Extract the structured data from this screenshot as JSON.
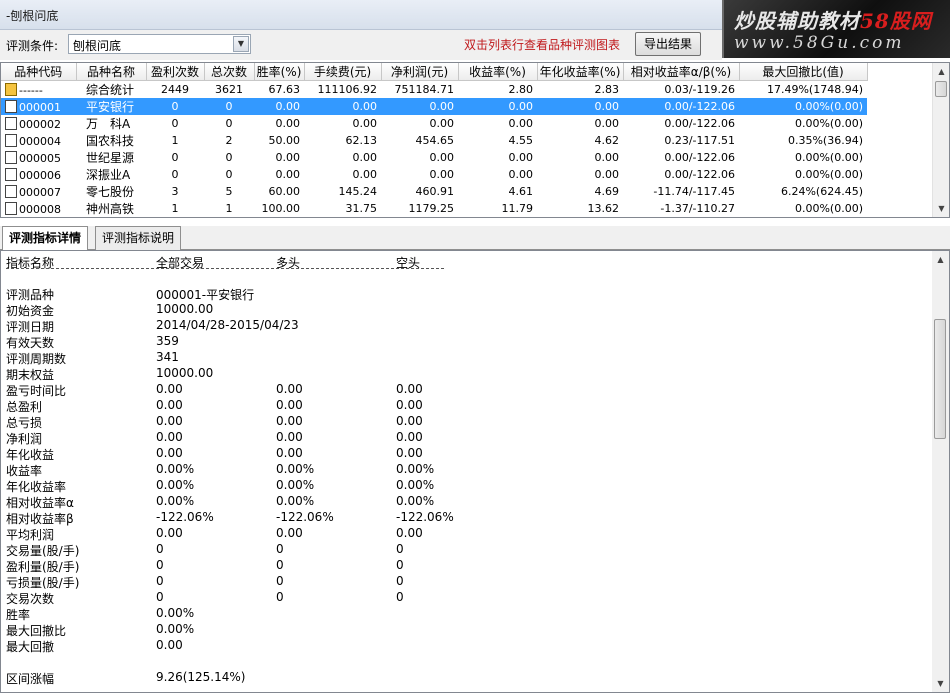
{
  "window": {
    "title": "-刨根问底"
  },
  "watermark": {
    "line1a": "炒股辅助教材",
    "line1b": "58股网",
    "line2": "www.58Gu.com"
  },
  "toolbar": {
    "criteria_label": "评测条件:",
    "criteria_value": "刨根问底",
    "hint": "双击列表行查看品种评测图表",
    "export_label": "导出结果"
  },
  "grid": {
    "columns": [
      "品种代码",
      "品种名称",
      "盈利次数",
      "总次数",
      "胜率(%)",
      "手续费(元)",
      "净利润(元)",
      "收益率(%)",
      "年化收益率(%)",
      "相对收益率α/β(%)",
      "最大回撤比(值)"
    ],
    "rows": [
      {
        "code": "------",
        "name": "综合统计",
        "win": "2449",
        "total": "3621",
        "rate": "67.63",
        "fee": "111106.92",
        "profit": "751184.71",
        "ret": "2.80",
        "annual": "2.83",
        "rel": "0.03/-119.26",
        "dd": "17.49%(1748.94)"
      },
      {
        "code": "000001",
        "name": "平安银行",
        "win": "0",
        "total": "0",
        "rate": "0.00",
        "fee": "0.00",
        "profit": "0.00",
        "ret": "0.00",
        "annual": "0.00",
        "rel": "0.00/-122.06",
        "dd": "0.00%(0.00)"
      },
      {
        "code": "000002",
        "name": "万　科A",
        "win": "0",
        "total": "0",
        "rate": "0.00",
        "fee": "0.00",
        "profit": "0.00",
        "ret": "0.00",
        "annual": "0.00",
        "rel": "0.00/-122.06",
        "dd": "0.00%(0.00)"
      },
      {
        "code": "000004",
        "name": "国农科技",
        "win": "1",
        "total": "2",
        "rate": "50.00",
        "fee": "62.13",
        "profit": "454.65",
        "ret": "4.55",
        "annual": "4.62",
        "rel": "0.23/-117.51",
        "dd": "0.35%(36.94)"
      },
      {
        "code": "000005",
        "name": "世纪星源",
        "win": "0",
        "total": "0",
        "rate": "0.00",
        "fee": "0.00",
        "profit": "0.00",
        "ret": "0.00",
        "annual": "0.00",
        "rel": "0.00/-122.06",
        "dd": "0.00%(0.00)"
      },
      {
        "code": "000006",
        "name": "深振业A",
        "win": "0",
        "total": "0",
        "rate": "0.00",
        "fee": "0.00",
        "profit": "0.00",
        "ret": "0.00",
        "annual": "0.00",
        "rel": "0.00/-122.06",
        "dd": "0.00%(0.00)"
      },
      {
        "code": "000007",
        "name": "零七股份",
        "win": "3",
        "total": "5",
        "rate": "60.00",
        "fee": "145.24",
        "profit": "460.91",
        "ret": "4.61",
        "annual": "4.69",
        "rel": "-11.74/-117.45",
        "dd": "6.24%(624.45)"
      },
      {
        "code": "000008",
        "name": "神州高铁",
        "win": "1",
        "total": "1",
        "rate": "100.00",
        "fee": "31.75",
        "profit": "1179.25",
        "ret": "11.79",
        "annual": "13.62",
        "rel": "-1.37/-110.27",
        "dd": "0.00%(0.00)"
      }
    ]
  },
  "tabs": [
    "评测指标详情",
    "评测指标说明"
  ],
  "detail": {
    "header": [
      "指标名称",
      "全部交易",
      "多头",
      "空头"
    ],
    "separator": "--------------------------------------------------------------------------",
    "rows": [
      [
        "评测品种",
        "000001-平安银行",
        "",
        ""
      ],
      [
        "初始资金",
        "10000.00",
        "",
        ""
      ],
      [
        "评测日期",
        "2014/04/28-2015/04/23",
        "",
        ""
      ],
      [
        "有效天数",
        "359",
        "",
        ""
      ],
      [
        "评测周期数",
        "341",
        "",
        ""
      ],
      [
        "期末权益",
        "10000.00",
        "",
        ""
      ],
      [
        "盈亏时间比",
        "0.00",
        "0.00",
        "0.00"
      ],
      [
        "总盈利",
        "0.00",
        "0.00",
        "0.00"
      ],
      [
        "总亏损",
        "0.00",
        "0.00",
        "0.00"
      ],
      [
        "净利润",
        "0.00",
        "0.00",
        "0.00"
      ],
      [
        "年化收益",
        "0.00",
        "0.00",
        "0.00"
      ],
      [
        "收益率",
        "0.00%",
        "0.00%",
        "0.00%"
      ],
      [
        "年化收益率",
        "0.00%",
        "0.00%",
        "0.00%"
      ],
      [
        "相对收益率α",
        "0.00%",
        "0.00%",
        "0.00%"
      ],
      [
        "相对收益率β",
        "-122.06%",
        "-122.06%",
        "-122.06%"
      ],
      [
        "平均利润",
        "0.00",
        "0.00",
        "0.00"
      ],
      [
        "交易量(股/手)",
        "0",
        "0",
        "0"
      ],
      [
        "盈利量(股/手)",
        "0",
        "0",
        "0"
      ],
      [
        "亏损量(股/手)",
        "0",
        "0",
        "0"
      ],
      [
        "交易次数",
        "0",
        "0",
        "0"
      ],
      [
        "胜率",
        "0.00%",
        "",
        ""
      ],
      [
        "最大回撤比",
        "0.00%",
        "",
        ""
      ],
      [
        "最大回撤",
        "0.00",
        "",
        ""
      ],
      [
        "",
        "",
        "",
        ""
      ],
      [
        "区间涨幅",
        "9.26(125.14%)",
        "",
        ""
      ]
    ]
  }
}
